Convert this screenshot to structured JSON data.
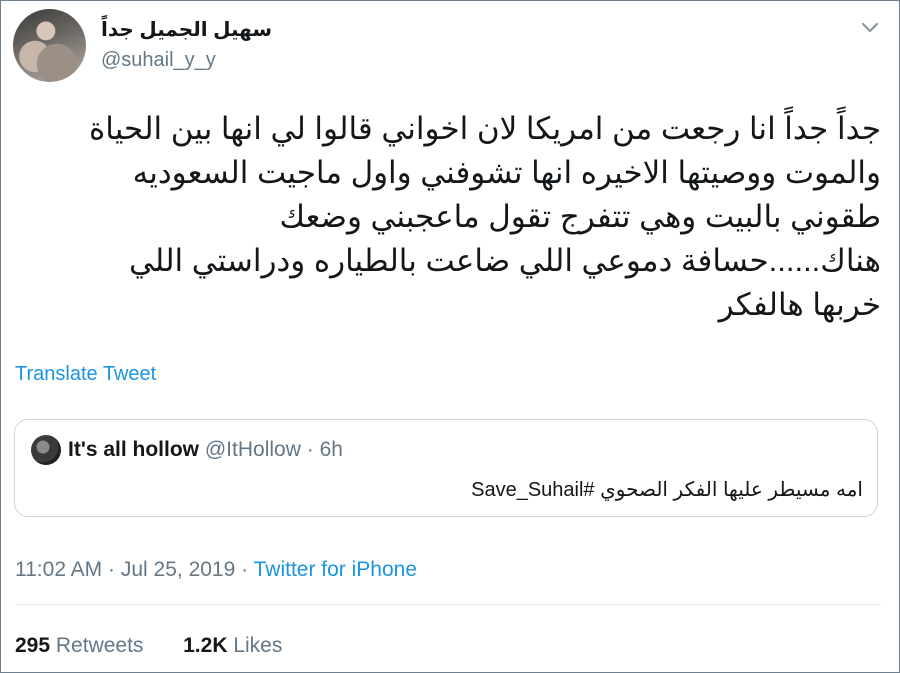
{
  "author": {
    "display_name": "سهيل الجميل جداً",
    "handle": "@suhail_y_y"
  },
  "tweet": {
    "lines": [
      "جداً جداً انا رجعت من امريكا لان اخواني قالوا لي انها بين الحياة",
      "والموت ووصيتها الاخيره انها تشوفني واول ماجيت السعوديه",
      "طقوني بالبيت وهي تتفرج تقول ماعجبني وضعك",
      "هناك......حسافة دموعي اللي ضاعت بالطياره ودراستي اللي",
      "خربها هالفكر"
    ],
    "translate_label": "Translate Tweet"
  },
  "quoted_tweet": {
    "name": "It's all hollow",
    "handle": "@ItHollow",
    "separator": "·",
    "time": "6h",
    "text": "امه مسيطر عليها الفكر الصحوي  #Save_Suhail"
  },
  "meta": {
    "time": "11:02 AM",
    "separator1": "·",
    "date": "Jul 25, 2019",
    "separator2": "·",
    "source": "Twitter for iPhone"
  },
  "stats": {
    "retweets_count": "295",
    "retweets_label": "Retweets",
    "likes_count": "1.2K",
    "likes_label": "Likes"
  },
  "colors": {
    "link": "#1b95e0",
    "secondary_text": "#657786",
    "primary_text": "#14171a"
  },
  "icons": {
    "caret": "chevron-down-icon"
  }
}
